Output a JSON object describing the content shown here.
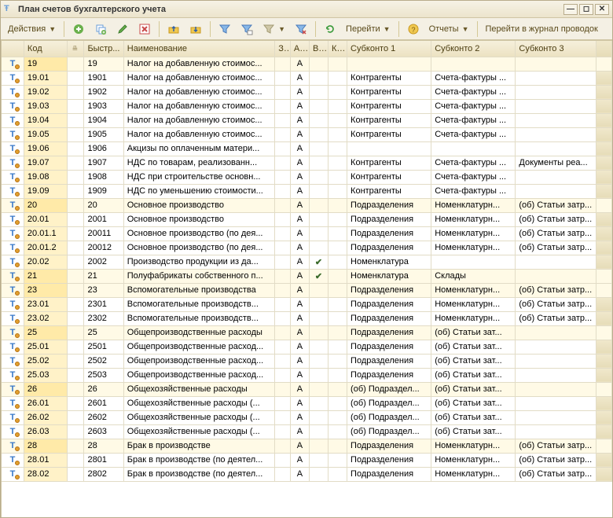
{
  "window": {
    "title": "План счетов бухгалтерского учета"
  },
  "toolbar": {
    "actions": "Действия",
    "goto": "Перейти",
    "reports": "Отчеты",
    "journal": "Перейти в журнал проводок"
  },
  "columns": {
    "code": "Код",
    "fast": "Быстр...",
    "name": "Наименование",
    "z": "З...",
    "a": "А...",
    "v": "В...",
    "k": "К...",
    "s1": "Субконто 1",
    "s2": "Субконто 2",
    "s3": "Субконто 3"
  },
  "rows": [
    {
      "group": true,
      "code": "19",
      "fast": "19",
      "name": "Налог на добавленную стоимос...",
      "a": "А",
      "v": "",
      "k": "",
      "s1": "",
      "s2": "",
      "s3": ""
    },
    {
      "code": "19.01",
      "fast": "1901",
      "name": "Налог на добавленную стоимос...",
      "a": "А",
      "v": "",
      "k": "",
      "s1": "Контрагенты",
      "s2": "Счета-фактуры ...",
      "s3": ""
    },
    {
      "code": "19.02",
      "fast": "1902",
      "name": "Налог на добавленную стоимос...",
      "a": "А",
      "v": "",
      "k": "",
      "s1": "Контрагенты",
      "s2": "Счета-фактуры ...",
      "s3": ""
    },
    {
      "code": "19.03",
      "fast": "1903",
      "name": "Налог на добавленную стоимос...",
      "a": "А",
      "v": "",
      "k": "",
      "s1": "Контрагенты",
      "s2": "Счета-фактуры ...",
      "s3": ""
    },
    {
      "code": "19.04",
      "fast": "1904",
      "name": "Налог на добавленную стоимос...",
      "a": "А",
      "v": "",
      "k": "",
      "s1": "Контрагенты",
      "s2": "Счета-фактуры ...",
      "s3": ""
    },
    {
      "code": "19.05",
      "fast": "1905",
      "name": "Налог на добавленную стоимос...",
      "a": "А",
      "v": "",
      "k": "",
      "s1": "Контрагенты",
      "s2": "Счета-фактуры ...",
      "s3": ""
    },
    {
      "code": "19.06",
      "fast": "1906",
      "name": "Акцизы по оплаченным матери...",
      "a": "А",
      "v": "",
      "k": "",
      "s1": "",
      "s2": "",
      "s3": ""
    },
    {
      "code": "19.07",
      "fast": "1907",
      "name": "НДС по товарам, реализованн...",
      "a": "А",
      "v": "",
      "k": "",
      "s1": "Контрагенты",
      "s2": "Счета-фактуры ...",
      "s3": "Документы реа..."
    },
    {
      "code": "19.08",
      "fast": "1908",
      "name": "НДС при строительстве основн...",
      "a": "А",
      "v": "",
      "k": "",
      "s1": "Контрагенты",
      "s2": "Счета-фактуры ...",
      "s3": ""
    },
    {
      "code": "19.09",
      "fast": "1909",
      "name": "НДС по уменьшению стоимости...",
      "a": "А",
      "v": "",
      "k": "",
      "s1": "Контрагенты",
      "s2": "Счета-фактуры ...",
      "s3": ""
    },
    {
      "group": true,
      "code": "20",
      "fast": "20",
      "name": "Основное производство",
      "a": "А",
      "v": "",
      "k": "",
      "s1": "Подразделения",
      "s2": "Номенклатурн...",
      "s3": "(об) Статьи затр..."
    },
    {
      "code": "20.01",
      "fast": "2001",
      "name": "Основное производство",
      "a": "А",
      "v": "",
      "k": "",
      "s1": "Подразделения",
      "s2": "Номенклатурн...",
      "s3": "(об) Статьи затр..."
    },
    {
      "code": "20.01.1",
      "fast": "20011",
      "name": "Основное производство (по дея...",
      "a": "А",
      "v": "",
      "k": "",
      "s1": "Подразделения",
      "s2": "Номенклатурн...",
      "s3": "(об) Статьи затр..."
    },
    {
      "code": "20.01.2",
      "fast": "20012",
      "name": "Основное производство (по дея...",
      "a": "А",
      "v": "",
      "k": "",
      "s1": "Подразделения",
      "s2": "Номенклатурн...",
      "s3": "(об) Статьи затр..."
    },
    {
      "code": "20.02",
      "fast": "2002",
      "name": "Производство продукции из да...",
      "a": "А",
      "v": "✔",
      "k": "",
      "s1": "Номенклатура",
      "s2": "",
      "s3": ""
    },
    {
      "group": true,
      "code": "21",
      "fast": "21",
      "name": "Полуфабрикаты собственного п...",
      "a": "А",
      "v": "✔",
      "k": "",
      "s1": "Номенклатура",
      "s2": "Склады",
      "s3": ""
    },
    {
      "group": true,
      "code": "23",
      "fast": "23",
      "name": "Вспомогательные производства",
      "a": "А",
      "v": "",
      "k": "",
      "s1": "Подразделения",
      "s2": "Номенклатурн...",
      "s3": "(об) Статьи затр..."
    },
    {
      "code": "23.01",
      "fast": "2301",
      "name": "Вспомогательные производств...",
      "a": "А",
      "v": "",
      "k": "",
      "s1": "Подразделения",
      "s2": "Номенклатурн...",
      "s3": "(об) Статьи затр..."
    },
    {
      "code": "23.02",
      "fast": "2302",
      "name": "Вспомогательные производств...",
      "a": "А",
      "v": "",
      "k": "",
      "s1": "Подразделения",
      "s2": "Номенклатурн...",
      "s3": "(об) Статьи затр..."
    },
    {
      "group": true,
      "code": "25",
      "fast": "25",
      "name": "Общепроизводственные расходы",
      "a": "А",
      "v": "",
      "k": "",
      "s1": "Подразделения",
      "s2": "(об) Статьи зат...",
      "s3": ""
    },
    {
      "code": "25.01",
      "fast": "2501",
      "name": "Общепроизводственные расход...",
      "a": "А",
      "v": "",
      "k": "",
      "s1": "Подразделения",
      "s2": "(об) Статьи зат...",
      "s3": ""
    },
    {
      "code": "25.02",
      "fast": "2502",
      "name": "Общепроизводственные расход...",
      "a": "А",
      "v": "",
      "k": "",
      "s1": "Подразделения",
      "s2": "(об) Статьи зат...",
      "s3": ""
    },
    {
      "code": "25.03",
      "fast": "2503",
      "name": "Общепроизводственные расход...",
      "a": "А",
      "v": "",
      "k": "",
      "s1": "Подразделения",
      "s2": "(об) Статьи зат...",
      "s3": ""
    },
    {
      "group": true,
      "code": "26",
      "fast": "26",
      "name": "Общехозяйственные расходы",
      "a": "А",
      "v": "",
      "k": "",
      "s1": "(об) Подраздел...",
      "s2": "(об) Статьи зат...",
      "s3": ""
    },
    {
      "code": "26.01",
      "fast": "2601",
      "name": "Общехозяйственные расходы (...",
      "a": "А",
      "v": "",
      "k": "",
      "s1": "(об) Подраздел...",
      "s2": "(об) Статьи зат...",
      "s3": ""
    },
    {
      "code": "26.02",
      "fast": "2602",
      "name": "Общехозяйственные расходы (...",
      "a": "А",
      "v": "",
      "k": "",
      "s1": "(об) Подраздел...",
      "s2": "(об) Статьи зат...",
      "s3": ""
    },
    {
      "code": "26.03",
      "fast": "2603",
      "name": "Общехозяйственные расходы (...",
      "a": "А",
      "v": "",
      "k": "",
      "s1": "(об) Подраздел...",
      "s2": "(об) Статьи зат...",
      "s3": ""
    },
    {
      "group": true,
      "code": "28",
      "fast": "28",
      "name": "Брак в производстве",
      "a": "А",
      "v": "",
      "k": "",
      "s1": "Подразделения",
      "s2": "Номенклатурн...",
      "s3": "(об) Статьи затр..."
    },
    {
      "code": "28.01",
      "fast": "2801",
      "name": "Брак в производстве (по деятел...",
      "a": "А",
      "v": "",
      "k": "",
      "s1": "Подразделения",
      "s2": "Номенклатурн...",
      "s3": "(об) Статьи затр..."
    },
    {
      "code": "28.02",
      "fast": "2802",
      "name": "Брак в производстве (по деятел...",
      "a": "А",
      "v": "",
      "k": "",
      "s1": "Подразделения",
      "s2": "Номенклатурн...",
      "s3": "(об) Статьи затр..."
    }
  ]
}
